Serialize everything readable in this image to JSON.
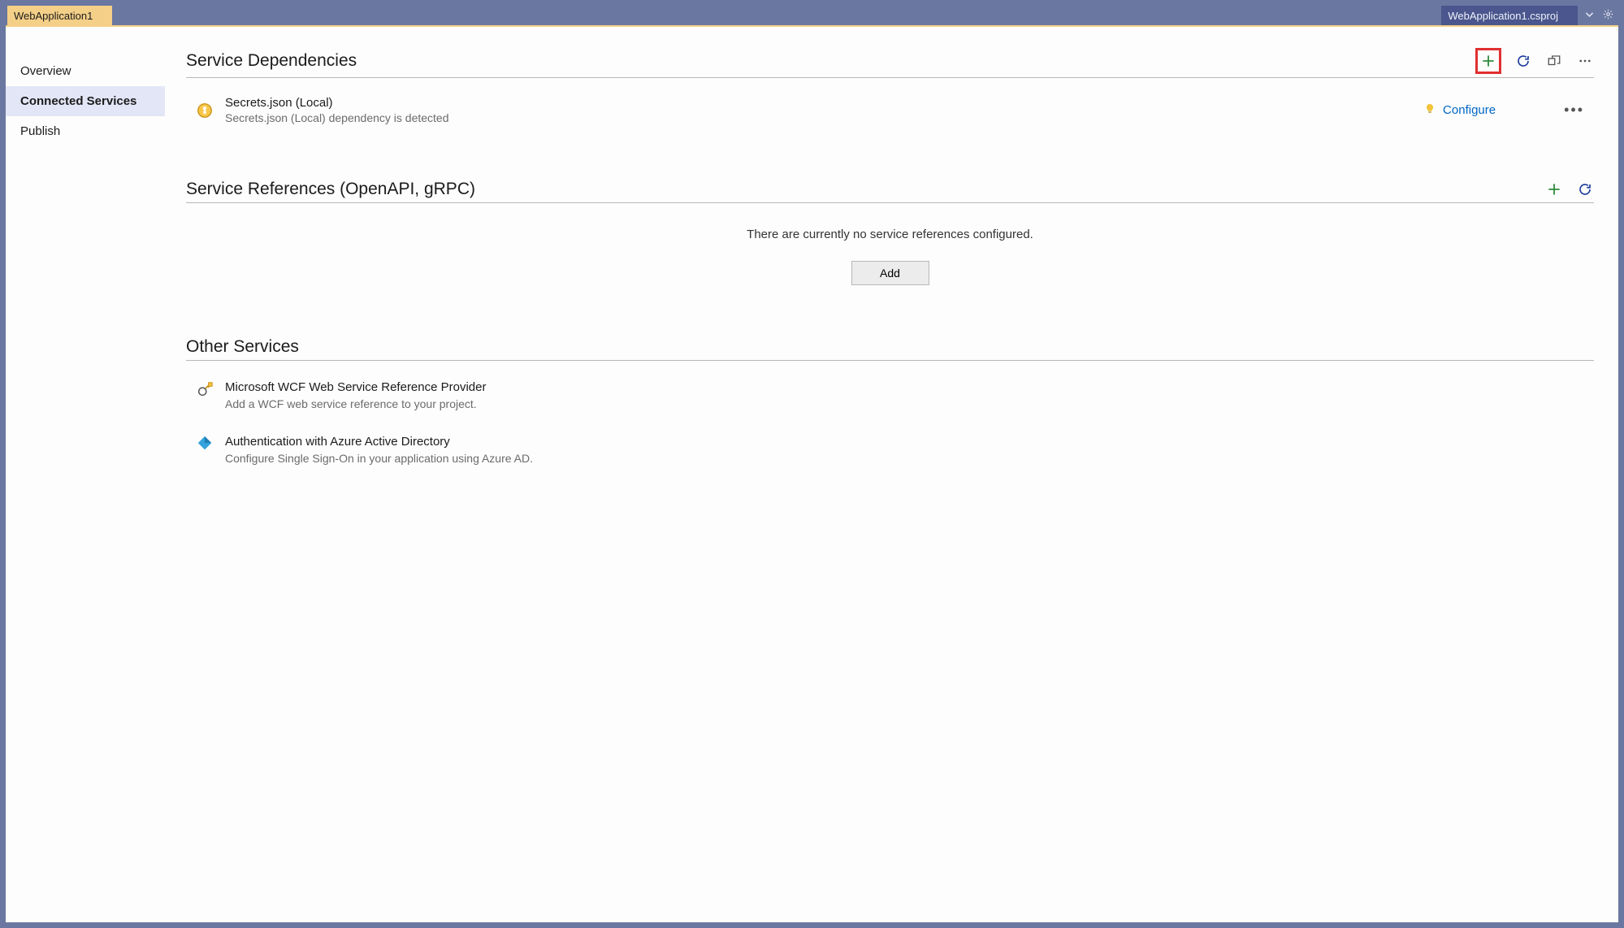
{
  "tabs": {
    "left": {
      "label": "WebApplication1"
    },
    "right": {
      "label": "WebApplication1.csproj"
    }
  },
  "sidebar": {
    "items": [
      {
        "label": "Overview"
      },
      {
        "label": "Connected Services"
      },
      {
        "label": "Publish"
      }
    ]
  },
  "sections": {
    "dependencies": {
      "title": "Service Dependencies",
      "items": [
        {
          "title": "Secrets.json (Local)",
          "description": "Secrets.json (Local) dependency is detected",
          "action": "Configure"
        }
      ]
    },
    "references": {
      "title": "Service References (OpenAPI, gRPC)",
      "empty_message": "There are currently no service references configured.",
      "add_button": "Add"
    },
    "other": {
      "title": "Other Services",
      "items": [
        {
          "title": "Microsoft WCF Web Service Reference Provider",
          "description": "Add a WCF web service reference to your project."
        },
        {
          "title": "Authentication with Azure Active Directory",
          "description": "Configure Single Sign-On in your application using Azure AD."
        }
      ]
    }
  }
}
